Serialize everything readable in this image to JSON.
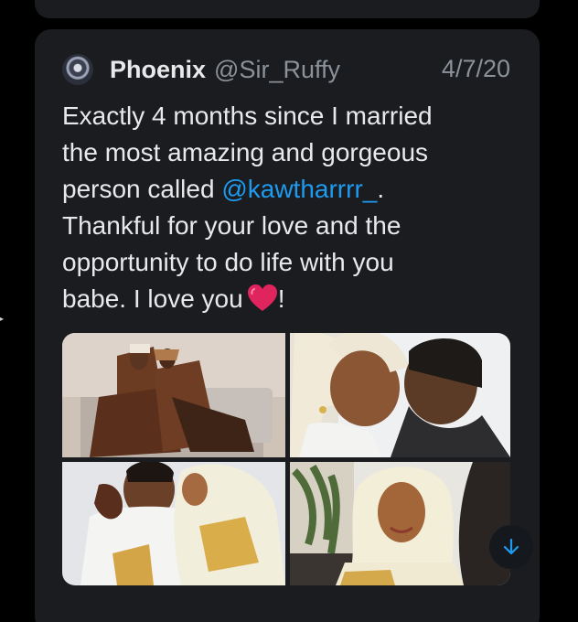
{
  "tweet": {
    "author_name": "Phoenix",
    "author_handle": "@Sir_Ruffy",
    "date": "4/7/20",
    "lines": [
      "Exactly 4 months since I married",
      "the most amazing and gorgeous"
    ],
    "line3_prefix": "person called ",
    "mention": "@kawtharrrr_",
    "line3_suffix": ".",
    "line4": "Thankful for your love and the",
    "line5": "opportunity to do life with you",
    "line6_prefix": "babe. I love you",
    "line6_suffix": "!"
  },
  "icons": {
    "avatar": "avatar",
    "heart": "heart-icon",
    "scroll": "arrow-down-icon"
  },
  "colors": {
    "background": "#000000",
    "card": "#1b1c1f",
    "text": "#e7e9ea",
    "muted": "#8b9299",
    "link": "#1d9bf0",
    "heart": "#e0245e",
    "scroll_arrow": "#1d9bf0"
  }
}
